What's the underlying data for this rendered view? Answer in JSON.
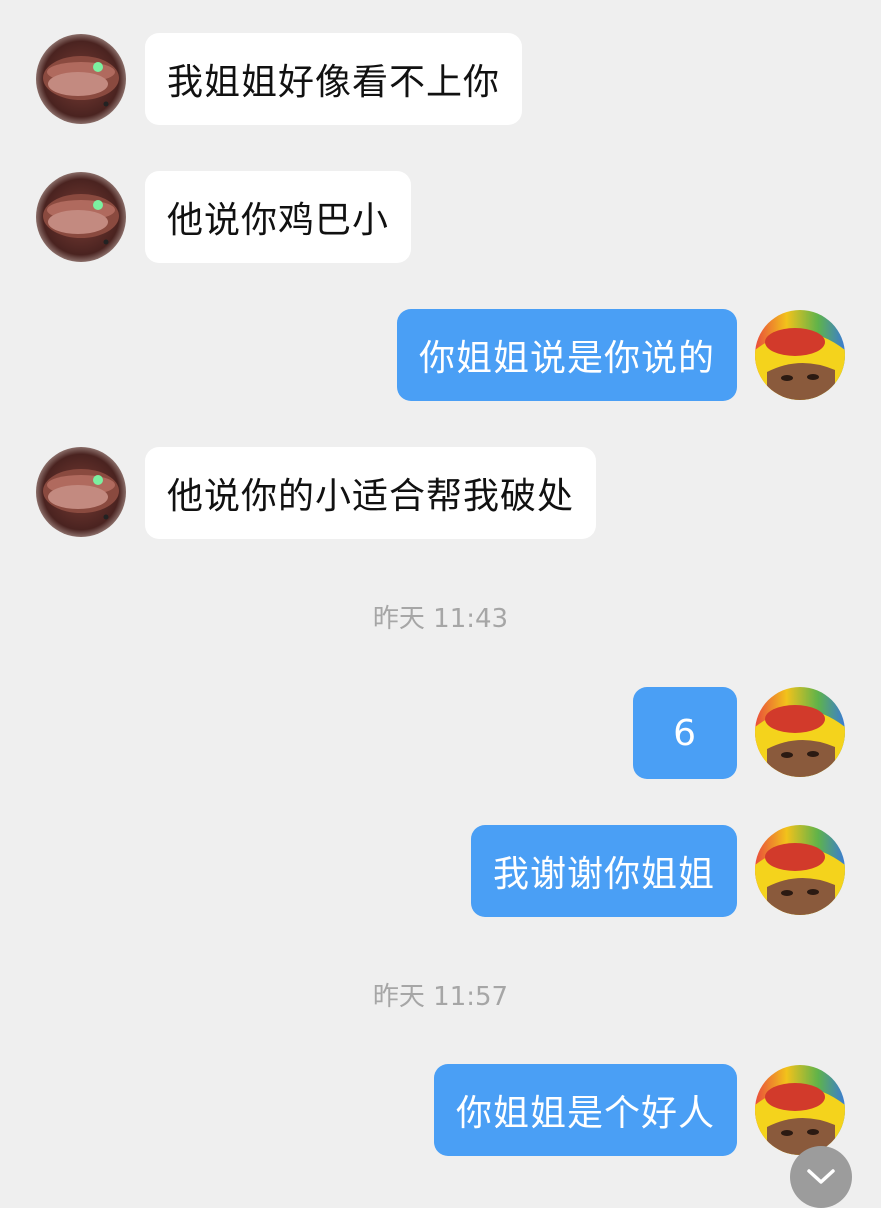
{
  "messages": [
    {
      "side": "left",
      "text": "我姐姐好像看不上你"
    },
    {
      "side": "left",
      "text": "他说你鸡巴小"
    },
    {
      "side": "right",
      "text": "你姐姐说是你说的"
    },
    {
      "side": "left",
      "text": "他说你的小适合帮我破处"
    },
    {
      "side": "right",
      "text": "6"
    },
    {
      "side": "right",
      "text": "我谢谢你姐姐"
    },
    {
      "side": "right",
      "text": "你姐姐是个好人"
    }
  ],
  "timestamps": [
    "昨天 11:43",
    "昨天 11:57"
  ],
  "colors": {
    "background": "#efefef",
    "incoming_bubble": "#ffffff",
    "outgoing_bubble": "#4a9ff5",
    "timestamp_text": "#a6a6a6"
  },
  "icons": {
    "incoming_avatar": "lips-avatar-icon",
    "outgoing_avatar": "yellow-hat-avatar-icon",
    "scroll_down": "chevron-down-icon"
  }
}
